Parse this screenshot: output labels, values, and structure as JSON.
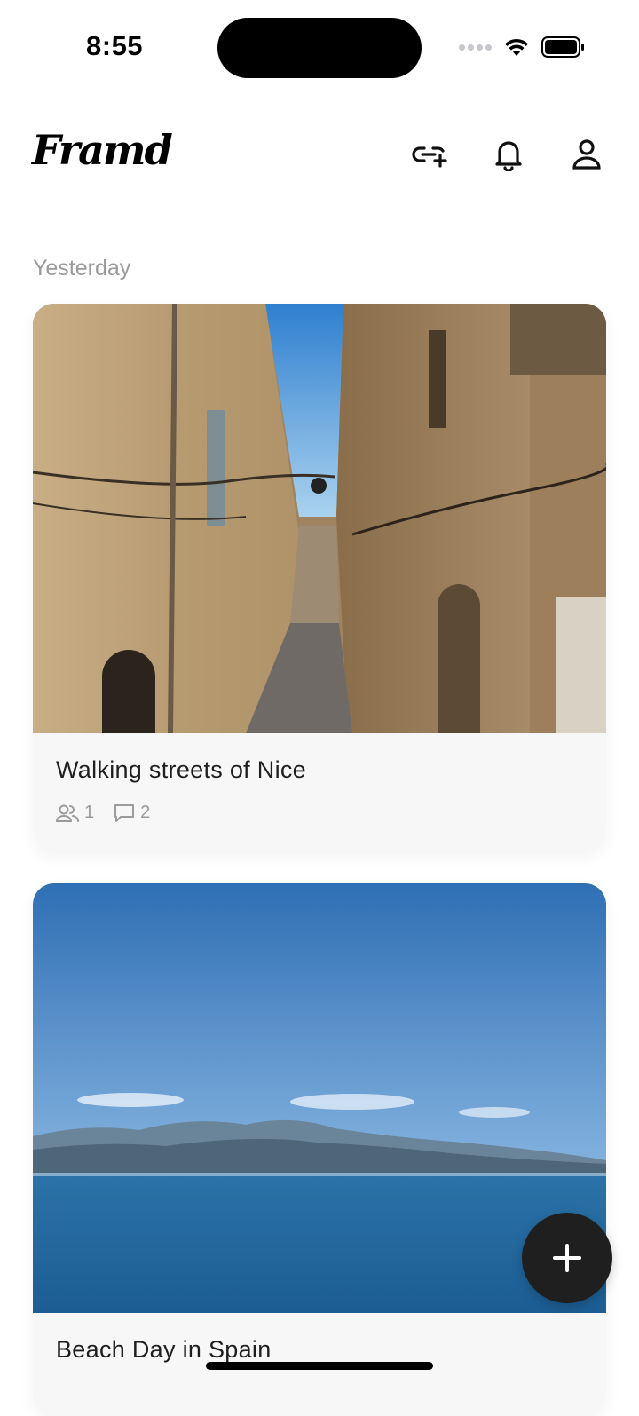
{
  "status_bar": {
    "time": "8:55"
  },
  "header": {
    "logo_text": "Framd",
    "icons": [
      "add-link-icon",
      "bell-icon",
      "profile-icon"
    ]
  },
  "feed": {
    "section_label": "Yesterday",
    "cards": [
      {
        "title": "Walking streets of Nice",
        "members_count": "1",
        "comments_count": "2",
        "image": "alley-photo"
      },
      {
        "title": "Beach Day in Spain",
        "image": "sea-photo"
      }
    ]
  },
  "fab": {
    "icon": "plus-icon"
  },
  "colors": {
    "fab_background": "#1f1f1f",
    "card_background": "#f7f7f7",
    "muted_text": "#9b9b9b"
  }
}
